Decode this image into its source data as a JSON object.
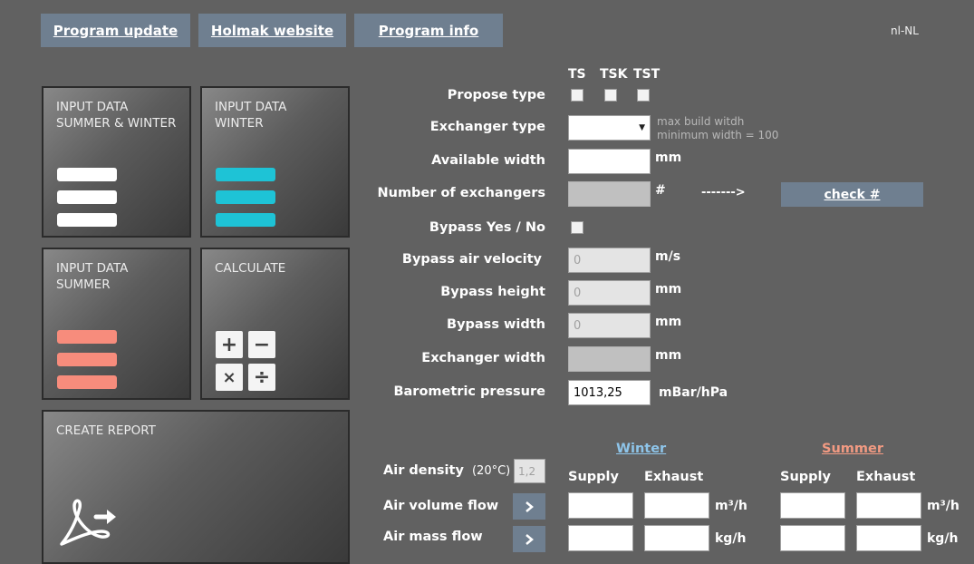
{
  "top": {
    "program_update": "Program update",
    "holmak_website": "Holmak website",
    "program_info": "Program info",
    "locale": "nl-NL"
  },
  "tiles": {
    "summer_winter": "INPUT DATA\nSUMMER & WINTER",
    "winter": "INPUT DATA\nWINTER",
    "summer": "INPUT DATA\nSUMMER",
    "calculate": "CALCULATE",
    "create_report": "CREATE REPORT"
  },
  "colors": {
    "white_bar": "#ffffff",
    "winter_bar": "#1ec3d6",
    "summer_bar": "#f78c7c",
    "winter_header": "#8ec5ea",
    "summer_header": "#f29a82"
  },
  "form": {
    "type_codes": [
      "TS",
      "TSK",
      "TST"
    ],
    "propose_type": "Propose type",
    "exchanger_type": "Exchanger type",
    "exchanger_hint1": "max build witdh",
    "exchanger_hint2": "minimum width = 100",
    "available_width": "Available width",
    "available_width_unit": "mm",
    "number_exchangers": "Number of exchangers",
    "number_unit": "#",
    "arrow_text": "------->",
    "check_button": "check #",
    "bypass_yes_no": "Bypass Yes / No",
    "bypass_velocity": "Bypass air velocity",
    "bypass_velocity_value": "0",
    "bypass_velocity_unit": "m/s",
    "bypass_height": "Bypass height",
    "bypass_height_value": "0",
    "bypass_height_unit": "mm",
    "bypass_width": "Bypass width",
    "bypass_width_value": "0",
    "bypass_width_unit": "mm",
    "exchanger_width": "Exchanger width",
    "exchanger_width_unit": "mm",
    "barometric": "Barometric pressure",
    "barometric_value": "1013,25",
    "barometric_unit": "mBar/hPa"
  },
  "air": {
    "winter": "Winter",
    "summer": "Summer",
    "supply": "Supply",
    "exhaust": "Exhaust",
    "density_label": "Air density",
    "density_temp": "(20°C)",
    "density_value": "1,2",
    "volume_flow": "Air volume flow",
    "volume_unit": "m³/h",
    "mass_flow": "Air mass flow",
    "mass_unit": "kg/h"
  }
}
